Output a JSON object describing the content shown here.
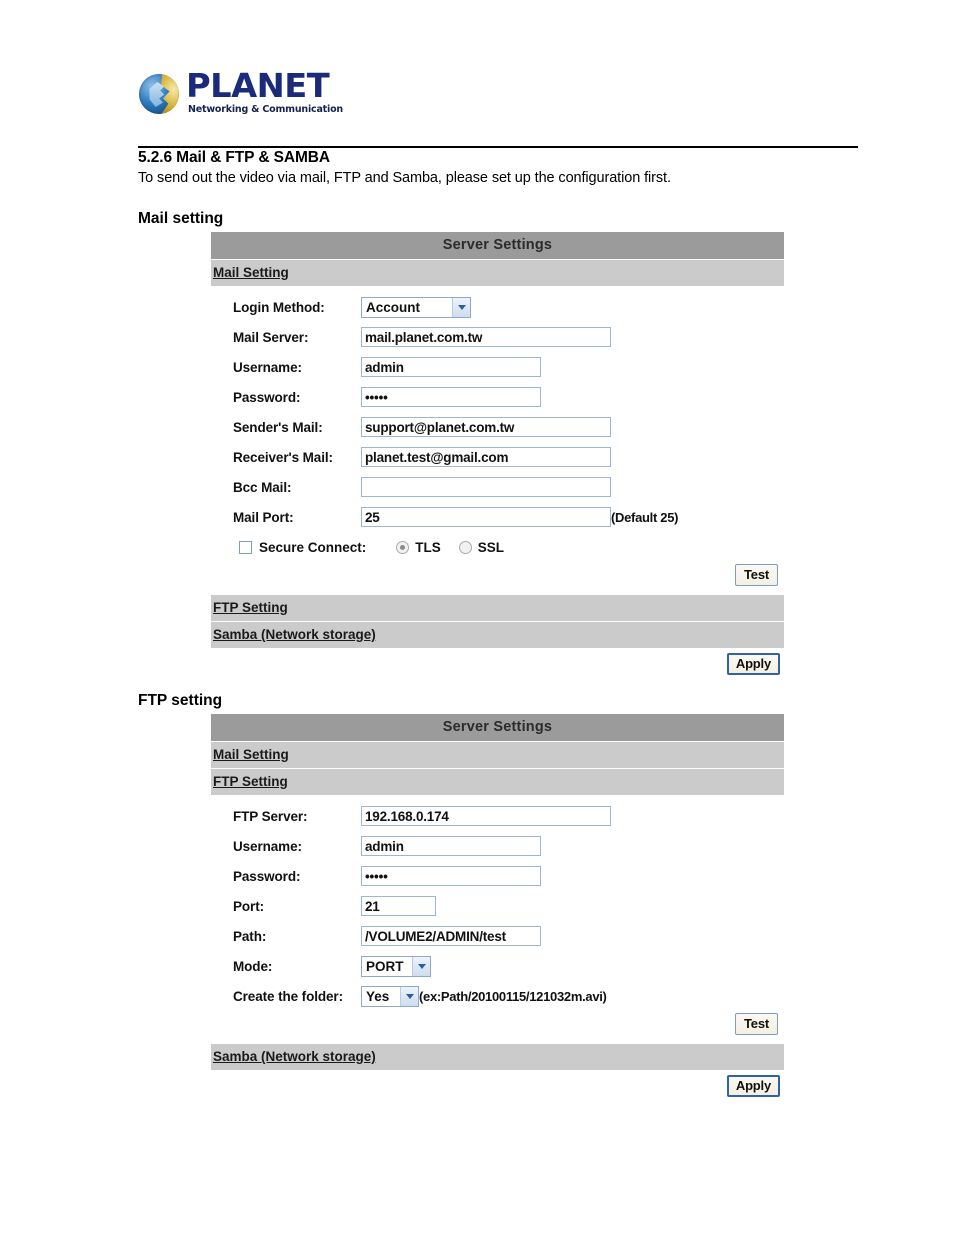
{
  "brand": {
    "name": "PLANET",
    "tagline": "Networking & Communication"
  },
  "document": {
    "section_number_title": "5.2.6 Mail & FTP & SAMBA",
    "description": "To send out the video via mail, FTP and Samba, please set up the configuration first.",
    "subheading_mail": "Mail setting",
    "subheading_ftp": "FTP setting"
  },
  "panel_mail": {
    "title": "Server Settings",
    "sections": {
      "mail": "Mail Setting",
      "ftp": "FTP Setting",
      "samba": "Samba (Network storage)"
    },
    "fields": {
      "login_method": {
        "label": "Login Method:",
        "value": "Account"
      },
      "mail_server": {
        "label": "Mail Server:",
        "value": "mail.planet.com.tw"
      },
      "username": {
        "label": "Username:",
        "value": "admin"
      },
      "password": {
        "label": "Password:",
        "value": "•••••"
      },
      "sender_mail": {
        "label": "Sender's Mail:",
        "value": "support@planet.com.tw"
      },
      "receiver_mail": {
        "label": "Receiver's Mail:",
        "value": "planet.test@gmail.com"
      },
      "bcc_mail": {
        "label": "Bcc Mail:",
        "value": ""
      },
      "mail_port": {
        "label": "Mail Port:",
        "value": "25",
        "hint": "(Default 25)"
      },
      "secure_connect": {
        "label": "Secure Connect:",
        "checked": false
      },
      "tls": {
        "label": "TLS",
        "selected": true
      },
      "ssl": {
        "label": "SSL",
        "selected": false
      }
    },
    "buttons": {
      "test": "Test",
      "apply": "Apply"
    }
  },
  "panel_ftp": {
    "title": "Server Settings",
    "sections": {
      "mail": "Mail Setting",
      "ftp": "FTP Setting",
      "samba": "Samba (Network storage)"
    },
    "fields": {
      "ftp_server": {
        "label": "FTP Server:",
        "value": "192.168.0.174"
      },
      "username": {
        "label": "Username:",
        "value": "admin"
      },
      "password": {
        "label": "Password:",
        "value": "•••••"
      },
      "port": {
        "label": "Port:",
        "value": "21"
      },
      "path": {
        "label": "Path:",
        "value": "/VOLUME2/ADMIN/test"
      },
      "mode": {
        "label": "Mode:",
        "value": "PORT"
      },
      "create_folder": {
        "label": "Create the folder:",
        "value": "Yes",
        "hint": "(ex:Path/20100115/121032m.avi)"
      }
    },
    "buttons": {
      "test": "Test",
      "apply": "Apply"
    }
  }
}
